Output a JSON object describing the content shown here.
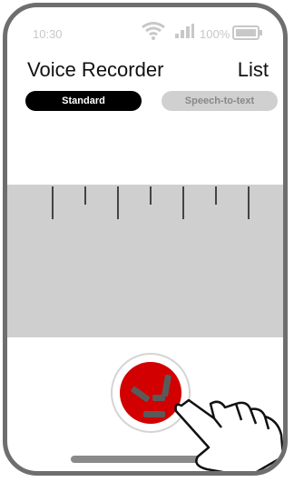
{
  "status_bar": {
    "time": "10:30",
    "battery_percent": "100%",
    "icons": [
      "wifi-icon",
      "cellular-signal-icon",
      "battery-icon"
    ]
  },
  "header": {
    "title": "Voice Recorder",
    "list_link": "List"
  },
  "tabs": [
    {
      "label": "Standard",
      "active": true
    },
    {
      "label": "Speech-to-text",
      "active": false
    }
  ],
  "record": {
    "state": "recording",
    "icon": "stop-square-icon",
    "color": "#d20000"
  },
  "gesture": {
    "icon": "tap-hand-icon"
  },
  "colors": {
    "accent": "#d20000",
    "tab_active_bg": "#000000",
    "tab_inactive_bg": "#d0d0d0",
    "waveform_bg": "#cfcfcf"
  }
}
